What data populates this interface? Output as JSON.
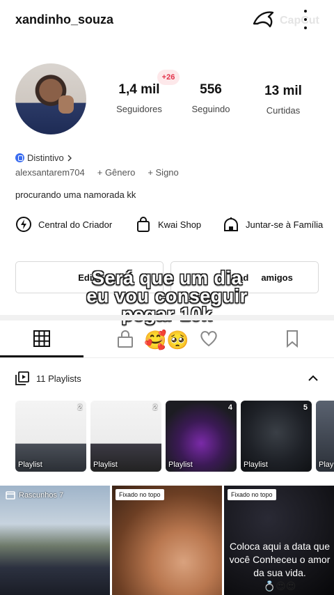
{
  "header": {
    "username": "xandinho_souza",
    "watermark": "CapCut"
  },
  "profile": {
    "new_followers_badge": "+26",
    "stats": [
      {
        "value": "1,4 mil",
        "label": "Seguidores"
      },
      {
        "value": "556",
        "label": "Seguindo"
      },
      {
        "value": "13 mil",
        "label": "Curtidas"
      }
    ],
    "distintivo": "Distintivo",
    "user_id": "alexsantarem704",
    "add_genero": "+ Gênero",
    "add_signo": "+ Signo",
    "bio": "procurando uma namorada kk"
  },
  "shortcuts": [
    {
      "label": "Central do Criador",
      "icon": "lightning-circle-icon"
    },
    {
      "label": "Kwai Shop",
      "icon": "shopping-bag-icon"
    },
    {
      "label": "Juntar-se à Família",
      "icon": "home-dome-icon"
    }
  ],
  "buttons": {
    "edit_partial": "Edit",
    "friends_prefix": "ad",
    "friends_suffix": "amigos"
  },
  "overlay_caption": [
    "Será que um dia",
    "eu vou conseguir",
    "pegar 10k"
  ],
  "tabs": {
    "emojis": "🥰🥺"
  },
  "playlists": {
    "label": "11 Playlists",
    "items": [
      {
        "title": "Playlist",
        "count": "2"
      },
      {
        "title": "Playlist",
        "count": "2"
      },
      {
        "title": "Playlist",
        "count": "4"
      },
      {
        "title": "Playlist",
        "count": "5"
      },
      {
        "title": "Play",
        "count": ""
      }
    ]
  },
  "grid": {
    "drafts_label": "Rascunhos 7",
    "pinned_label": "Fixado no topo",
    "pinned_label_2": "Fixado no topo",
    "card3_text": "Coloca aqui a data que você Conheceu o amor da sua vida.",
    "card3_emojis": "💍😍😍"
  },
  "colors": {
    "badge_red": "#e2324a",
    "shield_blue": "#3b6df0"
  }
}
